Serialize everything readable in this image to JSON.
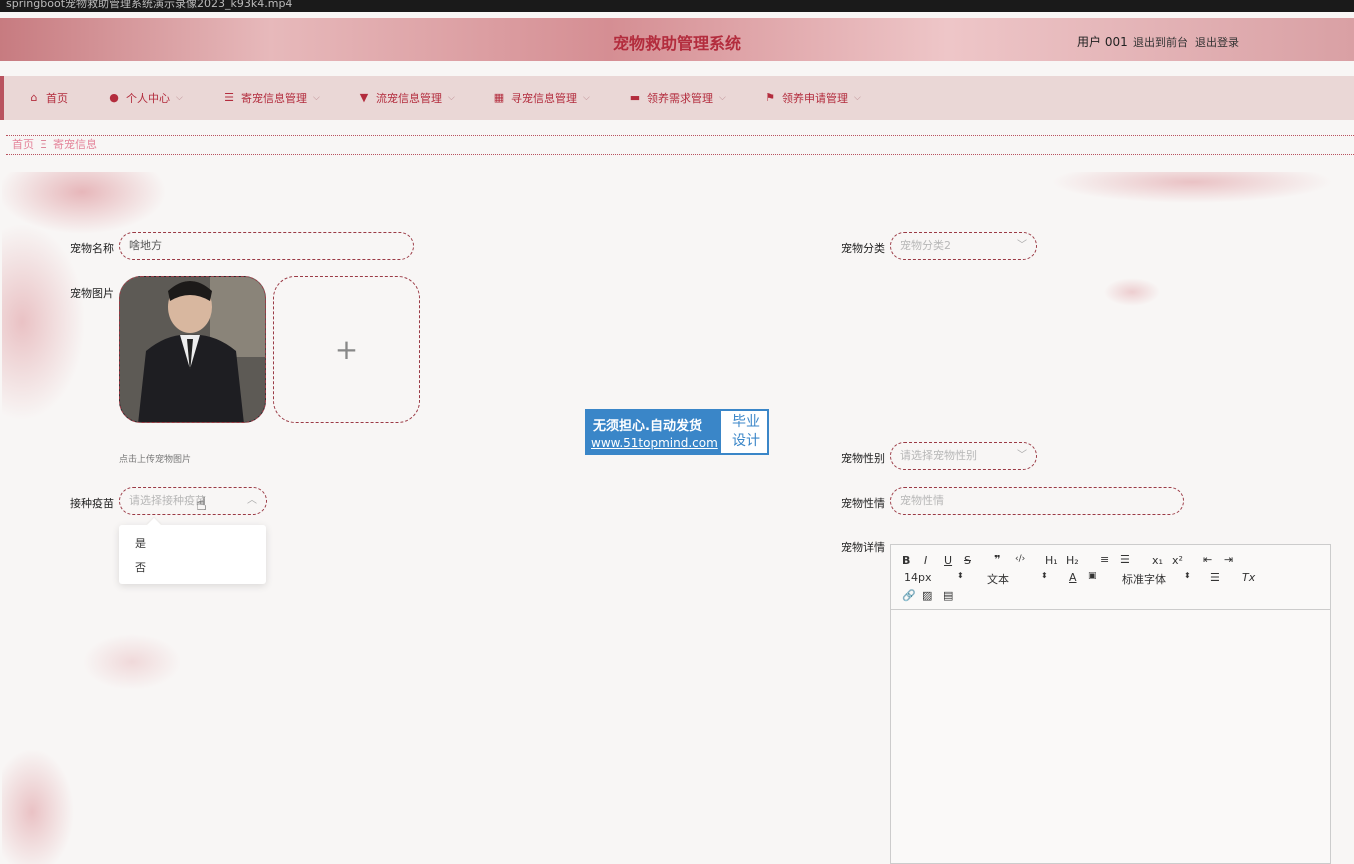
{
  "window": {
    "title": "springboot宠物救助管理系统演示录像2023_k93k4.mp4"
  },
  "header": {
    "title": "宠物救助管理系统",
    "user": "用户 001",
    "links": [
      "退出到前台",
      "退出登录"
    ]
  },
  "nav": {
    "items": [
      {
        "label": "首页",
        "icon": "home-icon",
        "has_dropdown": false
      },
      {
        "label": "个人中心",
        "icon": "user-icon",
        "has_dropdown": true
      },
      {
        "label": "寄宠信息管理",
        "icon": "list-icon",
        "has_dropdown": true
      },
      {
        "label": "流宠信息管理",
        "icon": "paint-icon",
        "has_dropdown": true
      },
      {
        "label": "寻宠信息管理",
        "icon": "grid-icon",
        "has_dropdown": true
      },
      {
        "label": "领养需求管理",
        "icon": "bookmark-icon",
        "has_dropdown": true
      },
      {
        "label": "领养申请管理",
        "icon": "flag-icon",
        "has_dropdown": true
      }
    ]
  },
  "breadcrumb": {
    "home": "首页",
    "separator": "Ξ",
    "current": "寄宠信息"
  },
  "form": {
    "pet_name": {
      "label": "宠物名称",
      "value": "啥地方"
    },
    "pet_category": {
      "label": "宠物分类",
      "value": "宠物分类2"
    },
    "pet_image": {
      "label": "宠物图片",
      "hint": "点击上传宠物图片",
      "add_symbol": "+"
    },
    "pet_gender": {
      "label": "宠物性别",
      "placeholder": "请选择宠物性别"
    },
    "vaccine": {
      "label": "接种疫苗",
      "placeholder": "请选择接种疫苗",
      "options": [
        "是",
        "否"
      ]
    },
    "pet_temper": {
      "label": "宠物性情",
      "placeholder": "宠物性情"
    },
    "pet_detail": {
      "label": "宠物详情"
    }
  },
  "editor": {
    "toolbar_row1": [
      "B",
      "I",
      "U",
      "S",
      "❞",
      "‹/›",
      "H₁",
      "H₂",
      "≡",
      "☰",
      "x₁",
      "x²",
      "⇤",
      "⇥"
    ],
    "font_size": "14px",
    "block_type": "文本",
    "font_family": "标准字体",
    "clear_format": "Tx"
  },
  "watermark": {
    "line1": "无须担心.自动发货",
    "line2": "www.51topmind.com",
    "right1": "毕业",
    "right2": "设计"
  },
  "colors": {
    "brand": "#b32c3d",
    "nav_bg": "#ead7d6",
    "border": "#9b3a45",
    "watermark": "#3a86c8"
  }
}
